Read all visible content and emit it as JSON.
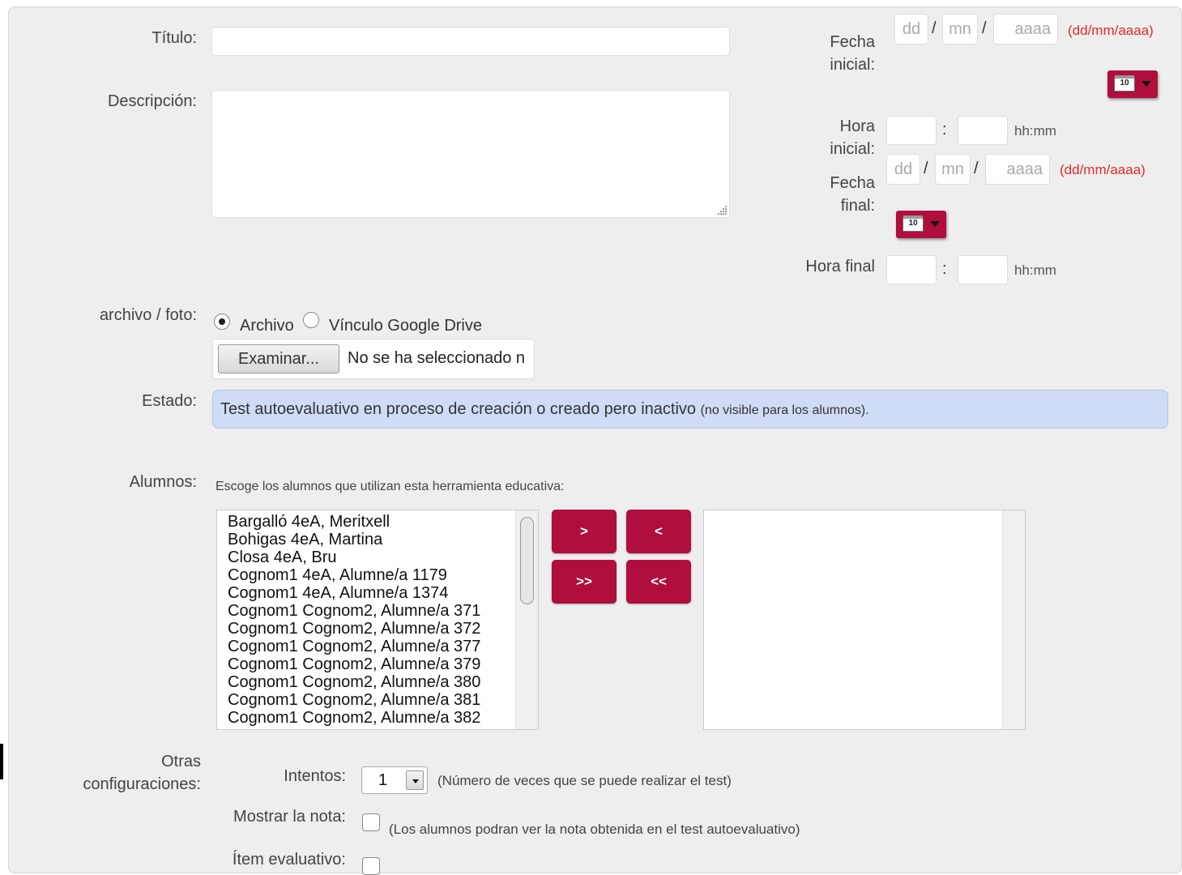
{
  "form": {
    "titulo_label": "Título:",
    "titulo_value": "",
    "descripcion_label": "Descripción:",
    "descripcion_value": "",
    "fecha_inicial_label": "Fecha inicial:",
    "fecha_final_label": "Fecha final:",
    "hora_inicial_label": "Hora inicial:",
    "hora_final_label": "Hora final",
    "date_placeholders": {
      "day": "dd",
      "month": "mn",
      "year": "aaaa"
    },
    "date_separator": "/",
    "date_format_hint": "(dd/mm/aaaa)",
    "time_separator": ":",
    "time_format_hint": "hh:mm",
    "calendar_icon_text": "10"
  },
  "archivo": {
    "label": "archivo / foto:",
    "option_archivo": "Archivo",
    "option_drive": "Vínculo Google Drive",
    "selected": "Archivo",
    "browse_button": "Examinar...",
    "file_status": "No se ha seleccionado n"
  },
  "estado": {
    "label": "Estado:",
    "text": "Test autoevaluativo en proceso de creación o creado pero inactivo",
    "note": "(no visible para los alumnos)."
  },
  "alumnos": {
    "label": "Alumnos:",
    "hint": "Escoge los alumnos que utilizan esta herramienta educativa:",
    "available": [
      "Bargalló 4eA, Meritxell",
      "Bohigas 4eA, Martina",
      "Closa 4eA, Bru",
      "Cognom1 4eA, Alumne/a 1179",
      "Cognom1 4eA, Alumne/a 1374",
      "Cognom1 Cognom2, Alumne/a 371",
      "Cognom1 Cognom2, Alumne/a 372",
      "Cognom1 Cognom2, Alumne/a 377",
      "Cognom1 Cognom2, Alumne/a 379",
      "Cognom1 Cognom2, Alumne/a 380",
      "Cognom1 Cognom2, Alumne/a 381",
      "Cognom1 Cognom2, Alumne/a 382"
    ],
    "selected": [],
    "buttons": {
      "add": ">",
      "remove": "<",
      "add_all": ">>",
      "remove_all": "<<"
    }
  },
  "otras": {
    "label": "Otras configuraciones:",
    "intentos_label": "Intentos:",
    "intentos_value": "1",
    "intentos_note": "(Número de veces que se puede realizar el test)",
    "mostrar_nota_label": "Mostrar la nota:",
    "mostrar_nota_note": "(Los alumnos podran ver la nota obtenida en el test autoevaluativo)",
    "mostrar_nota_checked": false,
    "item_evaluativo_label": "Ítem evaluativo:"
  },
  "colors": {
    "accent": "#b00e3c",
    "format_hint": "#e8282a",
    "estado_bg": "#d0dcf6",
    "panel_bg": "#eeeeee"
  }
}
